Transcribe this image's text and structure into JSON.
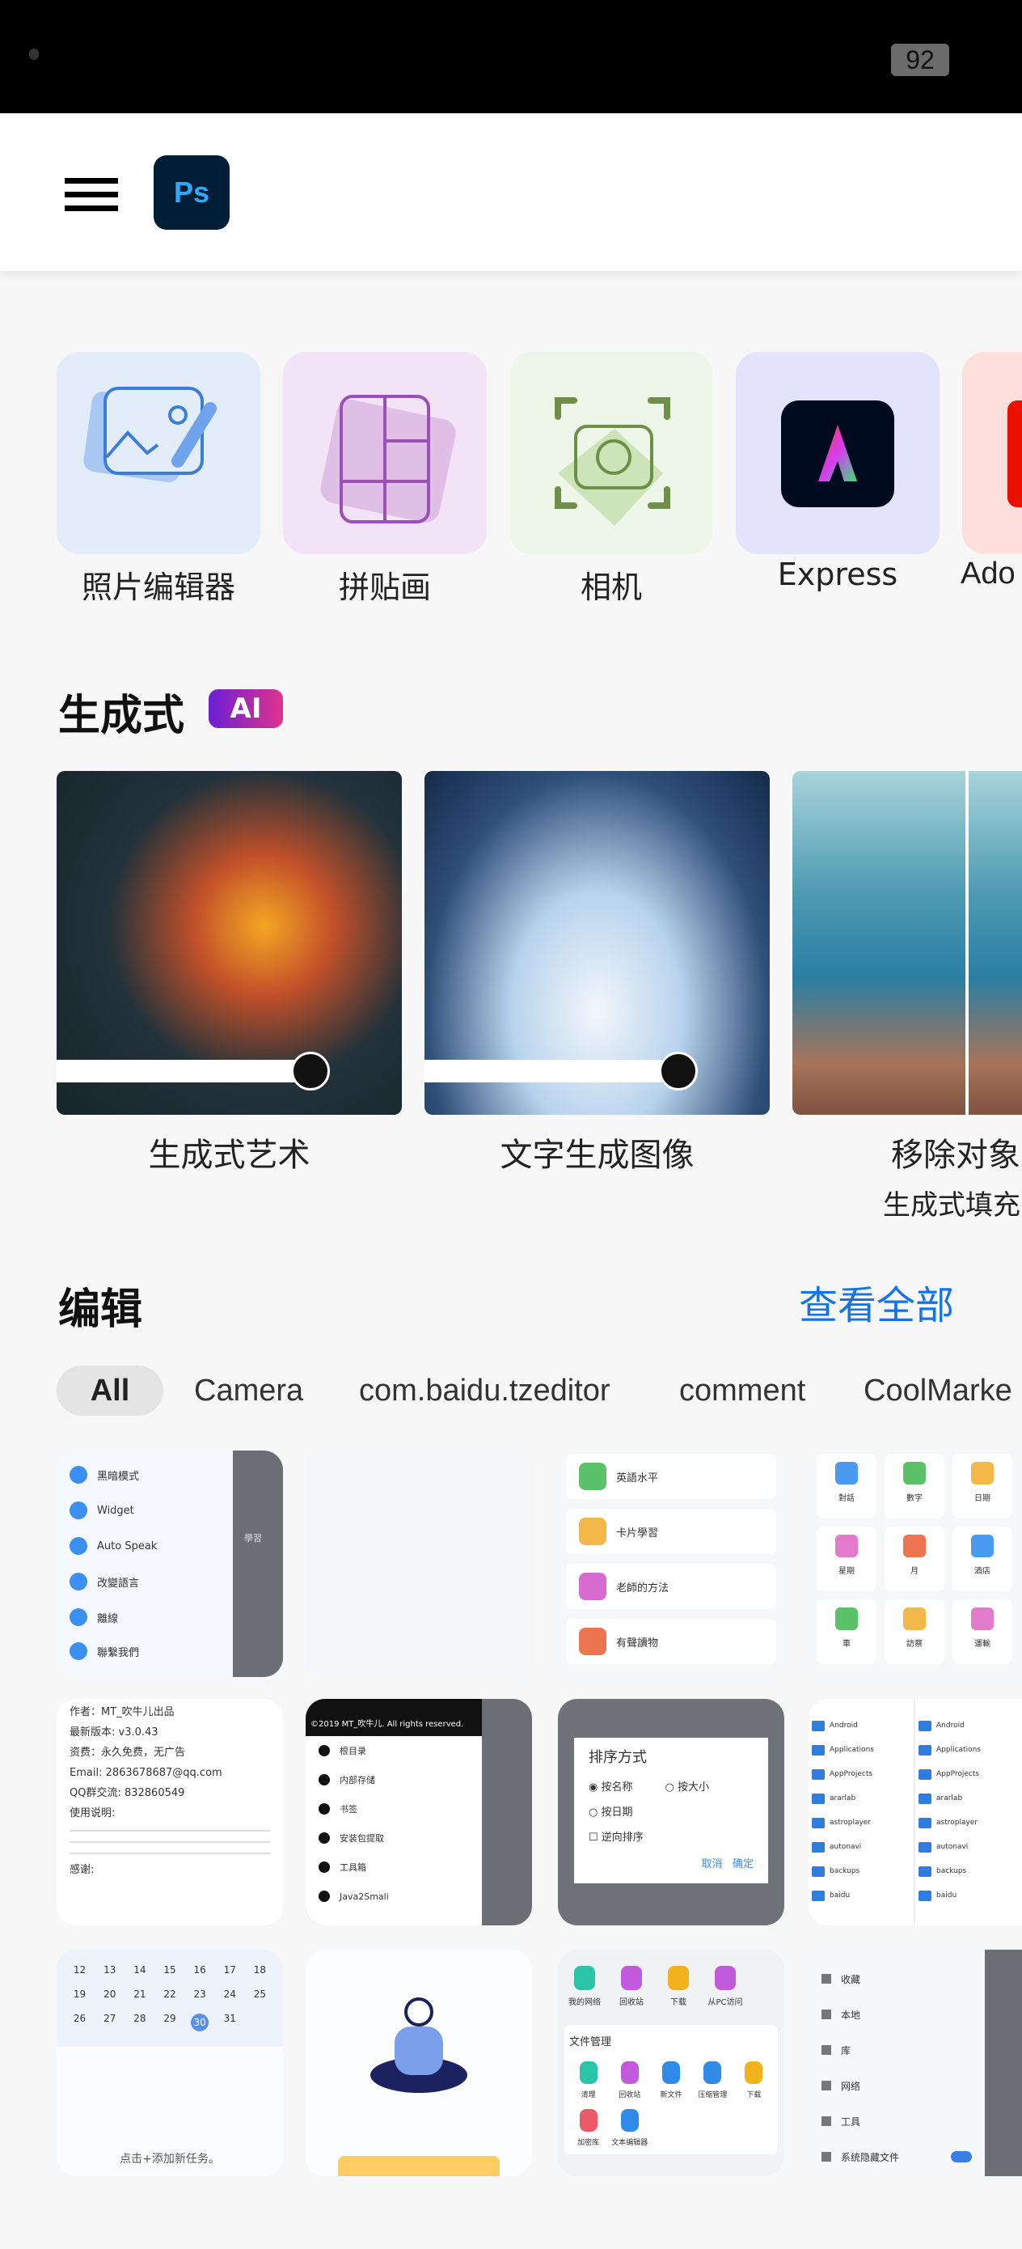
{
  "status_bar": {
    "battery": "92"
  },
  "header": {
    "menu_icon": "hamburger-icon",
    "logo": "Ps"
  },
  "quick_actions": [
    {
      "label": "照片编辑器",
      "icon": "photo-edit-icon",
      "bg": "#e3edfa"
    },
    {
      "label": "拼贴画",
      "icon": "collage-icon",
      "bg": "#f2e4f6"
    },
    {
      "label": "相机",
      "icon": "camera-icon",
      "bg": "#eef5e9"
    },
    {
      "label": "Express",
      "icon": "adobe-express-icon",
      "bg": "#e3e3fb"
    },
    {
      "label": "Ado",
      "icon": "adobe-icon",
      "bg": "#fde0dc"
    }
  ],
  "generative": {
    "title": "生成式",
    "badge": "AI",
    "cards": [
      {
        "label": "生成式艺术"
      },
      {
        "label": "文字生成图像"
      },
      {
        "label": "移除对象",
        "sublabel": "生成式填充"
      }
    ]
  },
  "edit": {
    "title": "编辑",
    "view_all": "查看全部",
    "chips": [
      "All",
      "Camera",
      "com.baidu.tzeditor",
      "comment",
      "CoolMarke"
    ],
    "thumbs": {
      "t1": [
        "黑暗模式",
        "Widget",
        "Auto Speak",
        "改變語言",
        "離線",
        "聯繫我們",
        "學習"
      ],
      "t3": [
        "英語水平",
        "卡片學習",
        "老師的方法",
        "有聲讀物"
      ],
      "t4": [
        "對話",
        "數字",
        "日期",
        "星期",
        "月",
        "酒店",
        "車",
        "訪察",
        "運輸"
      ],
      "t5": [
        "作者：MT_吹牛儿出品",
        "最新版本: v3.0.43",
        "资费：永久免费，无广告",
        "Email: 2863678687@qq.com",
        "QQ群交流: 832860549",
        "使用说明:",
        "感谢:"
      ],
      "t6": [
        "©2019 MT_吹牛儿. All rights reserved.",
        "根目录",
        "内部存储",
        "书签",
        "安装包提取",
        "工具箱",
        "Java2Smali"
      ],
      "t7": {
        "title": "排序方式",
        "options": [
          "按名称",
          "按大小",
          "按日期",
          "逆向排序"
        ],
        "cancel": "取消",
        "ok": "确定"
      },
      "t8": [
        "Android",
        "Applications",
        "AppProjects",
        "ararlab",
        "astroplayer",
        "autonavi",
        "backups",
        "baidu"
      ],
      "t9": {
        "days": [
          "12",
          "13",
          "14",
          "15",
          "16",
          "17",
          "18",
          "19",
          "20",
          "21",
          "22",
          "23",
          "24",
          "25",
          "26",
          "27",
          "28",
          "29",
          "30",
          "31"
        ],
        "hint": "点击+添加新任务。"
      },
      "t11": {
        "top": [
          "我的网络",
          "回收站",
          "下载",
          "从PC访问"
        ],
        "section": "文件管理",
        "items": [
          "清理",
          "回收站",
          "新文件",
          "压缩管理",
          "下载",
          "加密库",
          "文本编辑器"
        ]
      },
      "t12": [
        "收藏",
        "本地",
        "库",
        "网络",
        "工具",
        "系统隐藏文件"
      ]
    }
  },
  "colors": {
    "accent": "#1473e6",
    "background": "#f7f7f7"
  }
}
